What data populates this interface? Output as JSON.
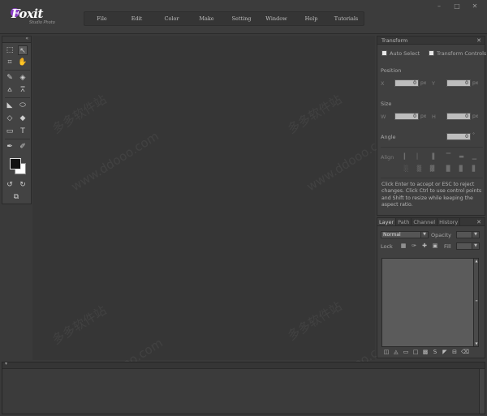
{
  "app": {
    "logo_text": "Foxit",
    "logo_sub": "Studio Photo",
    "brand_color": "#8b3fc8"
  },
  "window_controls": {
    "minimize": "–",
    "maximize": "□",
    "close": "✕"
  },
  "menu": {
    "items": [
      "File",
      "Edit",
      "Color",
      "Make",
      "Setting",
      "Window",
      "Help",
      "Tutorials"
    ]
  },
  "toolbox": {
    "collapse": "«",
    "tools": [
      {
        "name": "rect-select-icon",
        "glyph": "⬚"
      },
      {
        "name": "move-select-icon",
        "glyph": "↖"
      },
      {
        "name": "crop-icon",
        "glyph": "⌗"
      },
      {
        "name": "hand-icon",
        "glyph": "✋"
      },
      {
        "name": "brush-icon",
        "glyph": "✎"
      },
      {
        "name": "eraser-icon",
        "glyph": "◈"
      },
      {
        "name": "stamp-icon",
        "glyph": "⩟"
      },
      {
        "name": "heal-icon",
        "glyph": "⩞"
      },
      {
        "name": "bucket-icon",
        "glyph": "◣"
      },
      {
        "name": "shape-icon",
        "glyph": "⬭"
      },
      {
        "name": "eraser2-icon",
        "glyph": "◇"
      },
      {
        "name": "smudge-icon",
        "glyph": "◆"
      },
      {
        "name": "gradient-icon",
        "glyph": "▭"
      },
      {
        "name": "text-icon",
        "glyph": "T"
      },
      {
        "name": "pen-icon",
        "glyph": "✒"
      },
      {
        "name": "eyedropper-icon",
        "glyph": "✐"
      },
      {
        "name": "undo-icon",
        "glyph": "↺"
      },
      {
        "name": "redo-icon",
        "glyph": "↻"
      },
      {
        "name": "fit-icon",
        "glyph": "⧉"
      }
    ]
  },
  "transform": {
    "title": "Transform",
    "close": "✕",
    "auto_select": "Auto Select",
    "transform_controls": "Transform Controls",
    "position_label": "Position",
    "x_label": "X",
    "x_value": "0",
    "x_unit": "px",
    "y_label": "Y",
    "y_value": "0",
    "y_unit": "px",
    "size_label": "Size",
    "w_label": "W",
    "w_value": "0",
    "w_unit": "px",
    "h_label": "H",
    "h_value": "0",
    "h_unit": "px",
    "angle_label": "Angle",
    "angle_value": "0",
    "angle_unit": "°",
    "align_label": "Align",
    "hint": "Click Enter to accept or ESC to reject changes. Click Ctrl to use control points and Shift to resize while keeping the aspect ratio."
  },
  "layers": {
    "tabs": [
      "Layer",
      "Path",
      "Channel",
      "History"
    ],
    "close": "✕",
    "blend_mode": "Normal",
    "opacity_label": "Opacity",
    "lock_label": "Lock",
    "fill_label": "Fill"
  },
  "watermark": {
    "cn": "多多软件站",
    "en": "www.ddooo.com"
  }
}
